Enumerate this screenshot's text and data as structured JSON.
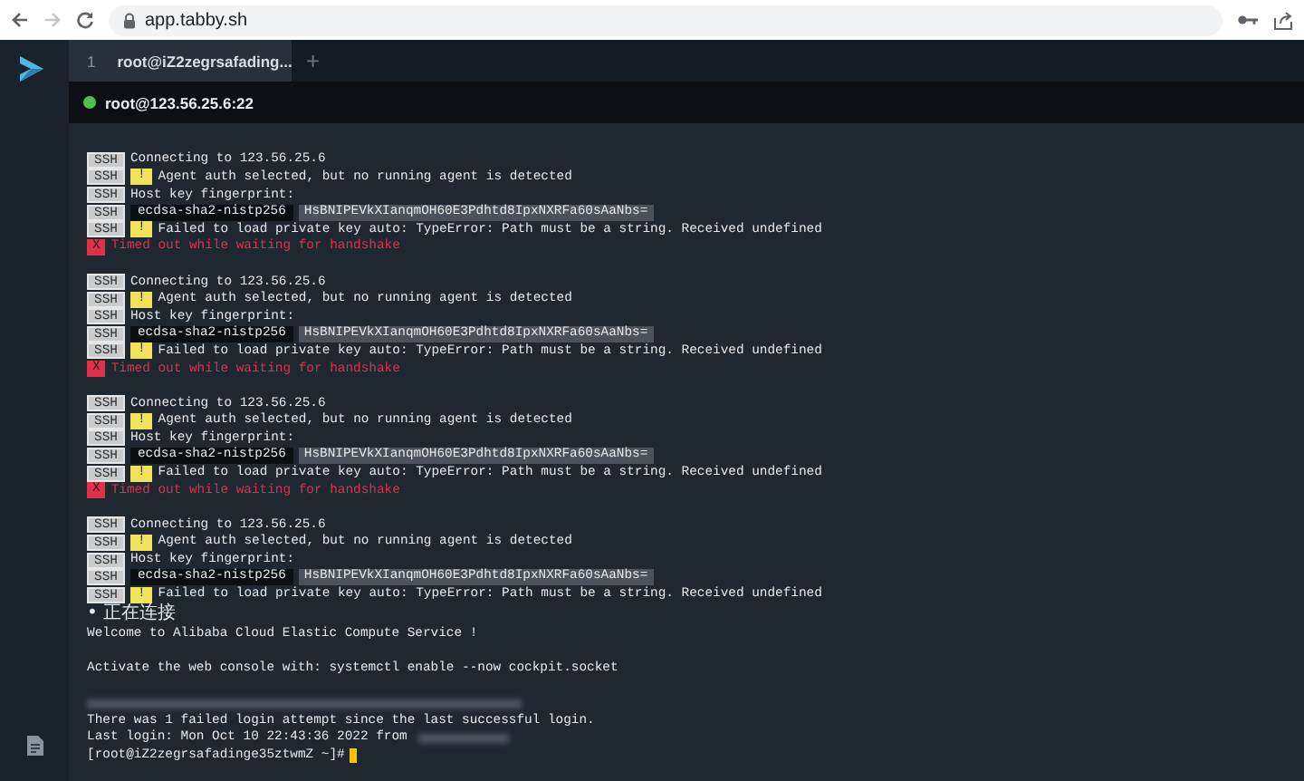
{
  "browser": {
    "url": "app.tabby.sh",
    "forward_disabled": true
  },
  "tabs": [
    {
      "number": "1",
      "title": "root@iZ2zegrsafading...",
      "selected": true
    }
  ],
  "new_tab": "+",
  "connection": {
    "host": "root@123.56.25.6:22",
    "connected": true
  },
  "terminal": {
    "cursor": true,
    "lines": [
      {
        "kind": "blank"
      },
      {
        "kind": "ssh",
        "tag": "SSH",
        "text": "Connecting to 123.56.25.6"
      },
      {
        "kind": "warn",
        "tag": "SSH",
        "badge": "!",
        "text": "Agent auth selected, but no running agent is detected"
      },
      {
        "kind": "ssh",
        "tag": "SSH",
        "text": "Host key fingerprint:"
      },
      {
        "kind": "key",
        "tag": "SSH",
        "algo": "ecdsa-sha2-nistp256",
        "key": "HsBNIPEVkXIanqmOH60E3Pdhtd8IpxNXRFa60sAaNbs="
      },
      {
        "kind": "warn",
        "tag": "SSH",
        "badge": "!",
        "text": "Failed to load private key auto: TypeError: Path must be a string. Received undefined"
      },
      {
        "kind": "error",
        "badge": "X",
        "text": "Timed out while waiting for handshake"
      },
      {
        "kind": "blank"
      },
      {
        "kind": "ssh",
        "tag": "SSH",
        "text": "Connecting to 123.56.25.6"
      },
      {
        "kind": "warn",
        "tag": "SSH",
        "badge": "!",
        "text": "Agent auth selected, but no running agent is detected"
      },
      {
        "kind": "ssh",
        "tag": "SSH",
        "text": "Host key fingerprint:"
      },
      {
        "kind": "key",
        "tag": "SSH",
        "algo": "ecdsa-sha2-nistp256",
        "key": "HsBNIPEVkXIanqmOH60E3Pdhtd8IpxNXRFa60sAaNbs="
      },
      {
        "kind": "warn",
        "tag": "SSH",
        "badge": "!",
        "text": "Failed to load private key auto: TypeError: Path must be a string. Received undefined"
      },
      {
        "kind": "error",
        "badge": "X",
        "text": "Timed out while waiting for handshake"
      },
      {
        "kind": "blank"
      },
      {
        "kind": "ssh",
        "tag": "SSH",
        "text": "Connecting to 123.56.25.6"
      },
      {
        "kind": "warn",
        "tag": "SSH",
        "badge": "!",
        "text": "Agent auth selected, but no running agent is detected"
      },
      {
        "kind": "ssh",
        "tag": "SSH",
        "text": "Host key fingerprint:"
      },
      {
        "kind": "key",
        "tag": "SSH",
        "algo": "ecdsa-sha2-nistp256",
        "key": "HsBNIPEVkXIanqmOH60E3Pdhtd8IpxNXRFa60sAaNbs="
      },
      {
        "kind": "warn",
        "tag": "SSH",
        "badge": "!",
        "text": "Failed to load private key auto: TypeError: Path must be a string. Received undefined"
      },
      {
        "kind": "error",
        "badge": "X",
        "text": "Timed out while waiting for handshake"
      },
      {
        "kind": "blank"
      },
      {
        "kind": "ssh",
        "tag": "SSH",
        "text": "Connecting to 123.56.25.6"
      },
      {
        "kind": "warn",
        "tag": "SSH",
        "badge": "!",
        "text": "Agent auth selected, but no running agent is detected"
      },
      {
        "kind": "ssh",
        "tag": "SSH",
        "text": "Host key fingerprint:"
      },
      {
        "kind": "key",
        "tag": "SSH",
        "algo": "ecdsa-sha2-nistp256",
        "key": "HsBNIPEVkXIanqmOH60E3Pdhtd8IpxNXRFa60sAaNbs="
      },
      {
        "kind": "warn",
        "tag": "SSH",
        "badge": "!",
        "text": "Failed to load private key auto: TypeError: Path must be a string. Received undefined"
      },
      {
        "kind": "cjk",
        "text": "• 正在连接"
      },
      {
        "kind": "plain",
        "text": "Welcome to Alibaba Cloud Elastic Compute Service !"
      },
      {
        "kind": "blank"
      },
      {
        "kind": "plain",
        "text": "Activate the web console with: systemctl enable --now cockpit.socket"
      },
      {
        "kind": "blank"
      },
      {
        "kind": "blurred"
      },
      {
        "kind": "plain",
        "text": "There was 1 failed login attempt since the last successful login."
      },
      {
        "kind": "blurred_tail",
        "text": "Last login: Mon Oct 10 22:43:36 2022 from"
      },
      {
        "kind": "prompt",
        "text": "[root@iZ2zegrsafadinge35ztwmZ ~]#"
      }
    ]
  }
}
